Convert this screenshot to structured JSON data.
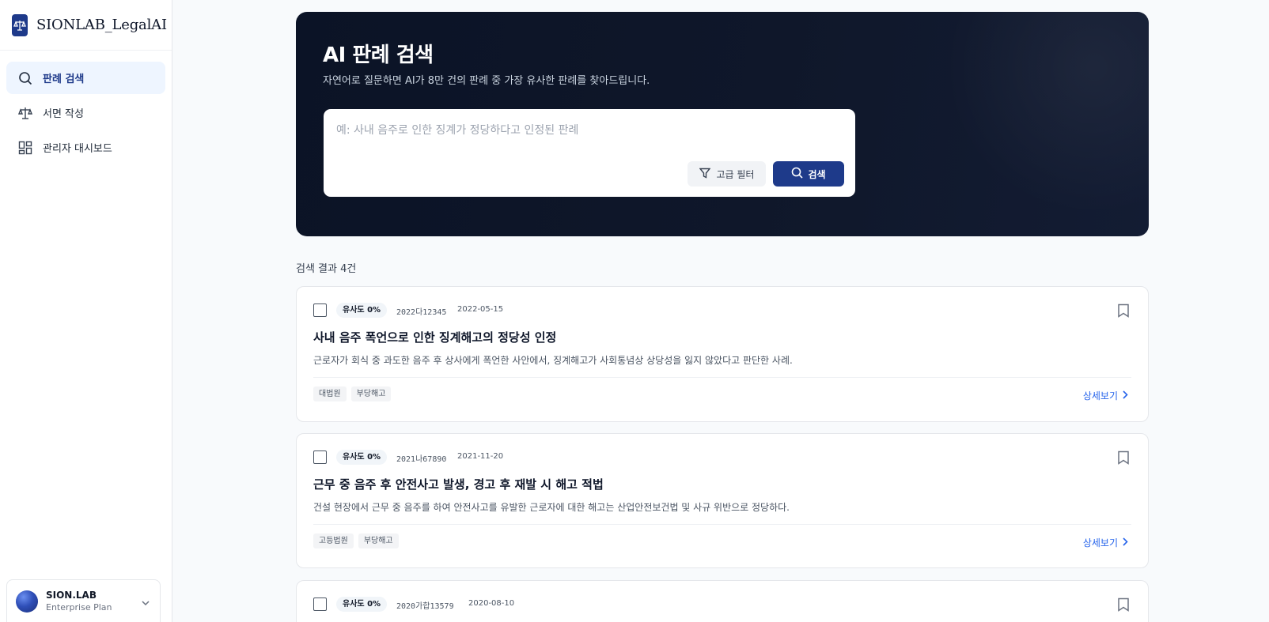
{
  "app": {
    "brand": "SIONLAB_LegalAI"
  },
  "sidebar": {
    "items": [
      {
        "label": "판례 검색",
        "icon": "search-icon",
        "active": true
      },
      {
        "label": "서면 작성",
        "icon": "scale-icon",
        "active": false
      },
      {
        "label": "관리자 대시보드",
        "icon": "dashboard-icon",
        "active": false
      }
    ],
    "account": {
      "name": "SION.LAB",
      "plan": "Enterprise Plan"
    }
  },
  "hero": {
    "title": "AI 판례 검색",
    "subtitle": "자연어로 질문하면 AI가 8만 건의 판례 중 가장 유사한 판례를 찾아드립니다.",
    "search": {
      "placeholder": "예: 사내 음주로 인한 징계가 정당하다고 인정된 판례",
      "value": "",
      "filter_label": "고급 필터",
      "submit_label": "검색"
    }
  },
  "results": {
    "count_label": "검색 결과 4건",
    "detail_label": "상세보기",
    "items": [
      {
        "similarity": "유사도 0%",
        "case_no": "2022다12345",
        "date": "2022-05-15",
        "title": "사내 음주 폭언으로 인한 징계해고의 정당성 인정",
        "summary": "근로자가 회식 중 과도한 음주 후 상사에게 폭언한 사안에서, 징계해고가 사회통념상 상당성을 잃지 않았다고 판단한 사례.",
        "tags": [
          "대법원",
          "부당해고"
        ]
      },
      {
        "similarity": "유사도 0%",
        "case_no": "2021나67890",
        "date": "2021-11-20",
        "title": "근무 중 음주 후 안전사고 발생, 경고 후 재발 시 해고 적법",
        "summary": "건설 현장에서 근무 중 음주를 하여 안전사고를 유발한 근로자에 대한 해고는 산업안전보건법 및 사규 위반으로 정당하다.",
        "tags": [
          "고등법원",
          "부당해고"
        ]
      },
      {
        "similarity": "유사도 0%",
        "case_no": "2020가합13579",
        "date": "2020-08-10"
      }
    ]
  },
  "colors": {
    "accent": "#1e3a8a",
    "hero_bg": "#0f172a",
    "link": "#2563eb"
  }
}
